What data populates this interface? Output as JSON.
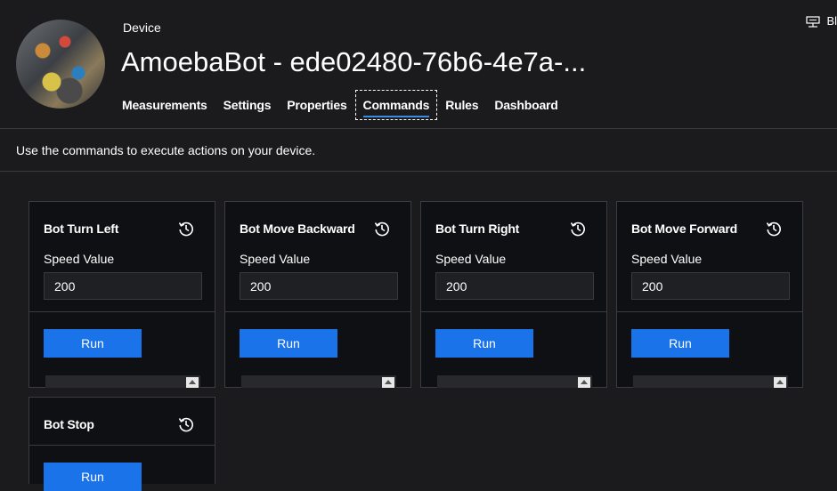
{
  "header": {
    "device_label": "Device",
    "device_title": "AmoebaBot - ede02480-76b6-4e7a-...",
    "top_right_text": "Bl"
  },
  "tabs": [
    {
      "label": "Measurements",
      "active": false
    },
    {
      "label": "Settings",
      "active": false
    },
    {
      "label": "Properties",
      "active": false
    },
    {
      "label": "Commands",
      "active": true
    },
    {
      "label": "Rules",
      "active": false
    },
    {
      "label": "Dashboard",
      "active": false
    }
  ],
  "description": "Use the commands to execute actions on your device.",
  "commands": [
    {
      "title": "Bot Turn Left",
      "field_label": "Speed Value",
      "value": "200",
      "run_label": "Run"
    },
    {
      "title": "Bot Move Backward",
      "field_label": "Speed Value",
      "value": "200",
      "run_label": "Run"
    },
    {
      "title": "Bot Turn Right",
      "field_label": "Speed Value",
      "value": "200",
      "run_label": "Run"
    },
    {
      "title": "Bot Move Forward",
      "field_label": "Speed Value",
      "value": "200",
      "run_label": "Run"
    },
    {
      "title": "Bot Stop",
      "run_label": "Run"
    }
  ],
  "colors": {
    "accent": "#1a73e8",
    "tab_underline": "#3a8dde",
    "background": "#1b1b1d",
    "card_background": "#0f1013"
  }
}
